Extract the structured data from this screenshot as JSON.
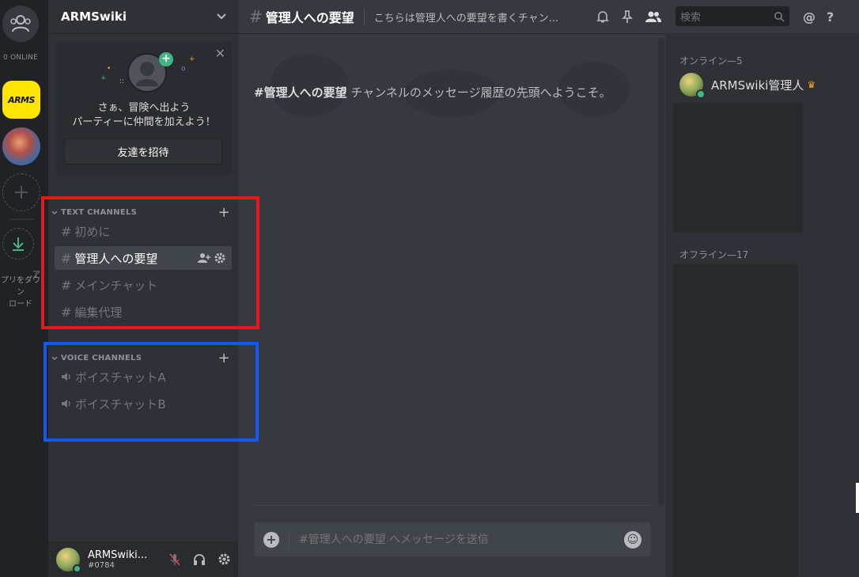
{
  "rail": {
    "online": "0 ONLINE",
    "arms_label": "ARMS",
    "download_label_1": "ア",
    "download_label_2": "プリをダウン",
    "download_label_3": "ロード"
  },
  "server": {
    "name": "ARMSwiki"
  },
  "invite": {
    "line1": "さぁ、冒険へ出よう",
    "line2": "パーティーに仲間を加えよう！",
    "button": "友達を招待"
  },
  "text_channels": {
    "title": "TEXT CHANNELS",
    "items": [
      {
        "name": "初めに"
      },
      {
        "name": "管理人への要望"
      },
      {
        "name": "メインチャット"
      },
      {
        "name": "編集代理"
      }
    ]
  },
  "voice_channels": {
    "title": "VOICE CHANNELS",
    "items": [
      {
        "name": "ボイスチャットA"
      },
      {
        "name": "ボイスチャットB"
      }
    ]
  },
  "user": {
    "name": "ARMSwiki...",
    "tag": "#0784"
  },
  "chat": {
    "channel": "管理人への要望",
    "topic": "こちらは管理人への要望を書くチャン...",
    "search_placeholder": "検索",
    "welcome_channel": "#管理人への要望",
    "welcome_text": " チャンネルのメッセージ履歴の先頭へようこそ。",
    "input_placeholder": "#管理人への要望 へメッセージを送信"
  },
  "members": {
    "online_header": "オンライン—5",
    "offline_header": "オフライン—17",
    "online_list": [
      {
        "name": "ARMSwiki管理人"
      }
    ]
  },
  "colors": {
    "highlight_red": "#e6191a",
    "highlight_blue": "#1158f5",
    "online_green": "#43b581"
  }
}
